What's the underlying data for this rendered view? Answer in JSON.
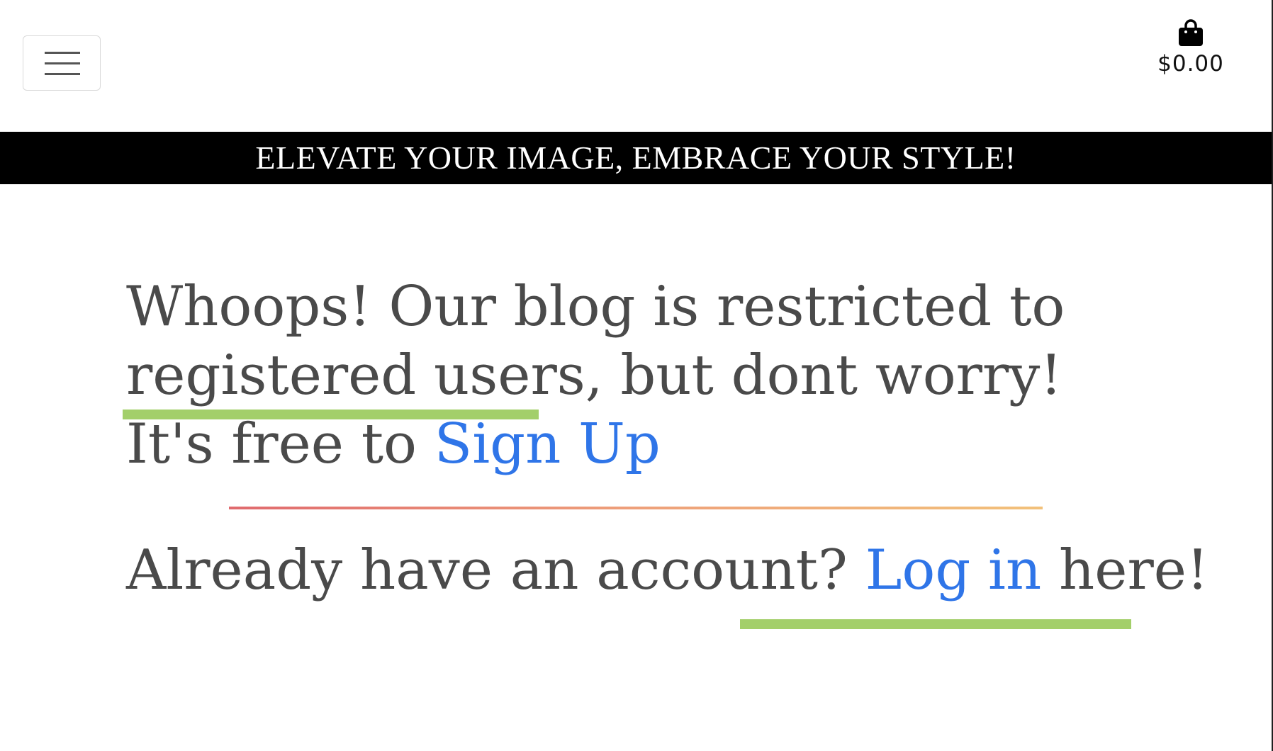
{
  "header": {
    "menu_icon": "hamburger-menu-icon",
    "cart_icon": "shopping-bag-icon",
    "cart_total": "$0.00"
  },
  "banner": {
    "text": "ELEVATE YOUR IMAGE, EMBRACE YOUR STYLE!"
  },
  "message": {
    "line_before_link": "Whoops! Our blog is restricted to registered users, but dont worry! It's free to",
    "signup_link": "Sign Up"
  },
  "login": {
    "prefix": "Already have an account?",
    "link": "Log in",
    "suffix": "here!"
  },
  "colors": {
    "text": "#4a4a4a",
    "link": "#2f75e8",
    "banner_bg": "#000000",
    "highlight": "#a3cf6a",
    "divider_start": "#e06a6e",
    "divider_end": "#f2c17a"
  }
}
